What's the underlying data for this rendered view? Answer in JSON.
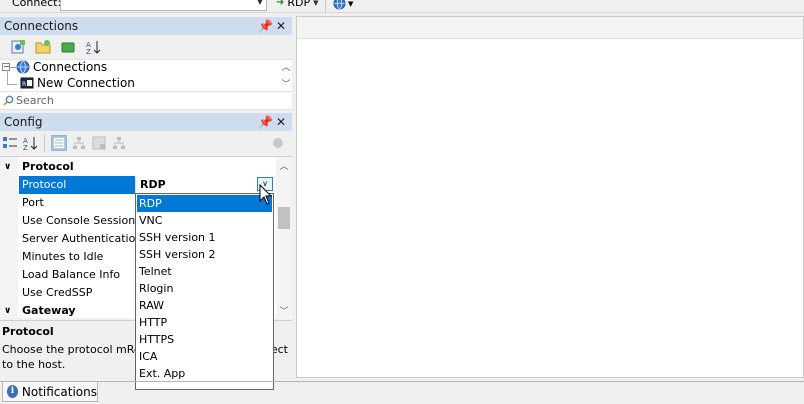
{
  "toolbar": {
    "connect_label": "Connect:",
    "protocol_selected": "RDP",
    "icons": [
      "arrow-icon",
      "globe-icon"
    ]
  },
  "connections_panel": {
    "title": "Connections",
    "toolbar_icons": [
      "new-connection-icon",
      "new-folder-icon",
      "view-icon",
      "sort-az-icon"
    ],
    "tree": [
      {
        "label": "Connections",
        "icon": "globe-icon",
        "expanded": true
      },
      {
        "label": "New Connection",
        "icon": "rdp-icon"
      }
    ],
    "search_placeholder": "Search"
  },
  "config_panel": {
    "title": "Config",
    "categories": [
      {
        "label": "Protocol",
        "expanded": true
      },
      {
        "label": "Gateway",
        "expanded": true
      }
    ],
    "properties": [
      {
        "name": "Protocol",
        "value": "RDP",
        "selected": true
      },
      {
        "name": "Port",
        "value": ""
      },
      {
        "name": "Use Console Session",
        "value": ""
      },
      {
        "name": "Server Authentication",
        "value": ""
      },
      {
        "name": "Minutes to Idle",
        "value": ""
      },
      {
        "name": "Load Balance Info",
        "value": ""
      },
      {
        "name": "Use CredSSP",
        "value": ""
      }
    ],
    "help_title": "Protocol",
    "help_text": "Choose the protocol mRemoteNG should use to connect to the host.",
    "help_text_visible_line1": "Choose the protocol mRen",
    "help_text_visible_tail": "ect",
    "help_text_visible_line2": "to the host."
  },
  "dropdown": {
    "options": [
      "RDP",
      "VNC",
      "SSH version 1",
      "SSH version 2",
      "Telnet",
      "Rlogin",
      "RAW",
      "HTTP",
      "HTTPS",
      "ICA",
      "Ext. App"
    ],
    "selected_index": 0
  },
  "bottom_tabs": [
    {
      "label": "Notifications",
      "icon": "info-icon"
    }
  ],
  "colors": {
    "panel_title_bg": "#cddcee",
    "selection": "#0078d7",
    "window_bg": "#f0f0f0"
  }
}
